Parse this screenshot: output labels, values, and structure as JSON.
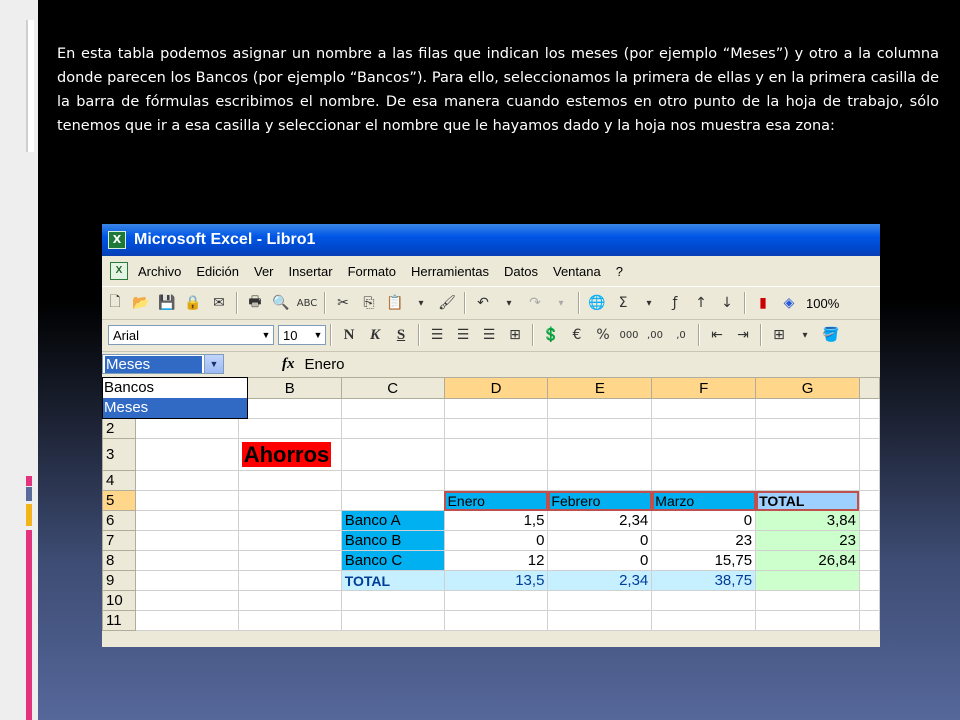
{
  "slide": {
    "paragraph": "En esta tabla podemos asignar un nombre a las filas que indican los meses (por ejemplo “Meses”) y otro a la columna donde parecen los Bancos (por ejemplo “Bancos”). Para ello, seleccionamos la primera de ellas y en la primera casilla de la barra de fórmulas escribimos el nombre. De esa manera cuando estemos en otro punto de la hoja de trabajo, sólo tenemos que ir a esa casilla y seleccionar el nombre que le hayamos dado y la hoja nos muestra esa zona:"
  },
  "excel": {
    "title": "Microsoft Excel - Libro1",
    "menu": [
      "Archivo",
      "Edición",
      "Ver",
      "Insertar",
      "Formato",
      "Herramientas",
      "Datos",
      "Ventana",
      "?"
    ],
    "zoom": "100%",
    "font_name": "Arial",
    "font_size": "10",
    "name_box": "Meses",
    "formula": "Enero",
    "name_options": [
      "Bancos",
      "Meses"
    ],
    "columns": [
      "A",
      "B",
      "C",
      "D",
      "E",
      "F",
      "G"
    ],
    "rows": {
      "r2": "2",
      "r3": "3",
      "r4": "4",
      "r5": "5",
      "r6": "6",
      "r7": "7",
      "r8": "8",
      "r9": "9",
      "r10": "10",
      "r11": "11"
    },
    "title_cell": "Ahorros",
    "headers": [
      "Enero",
      "Febrero",
      "Marzo",
      "TOTAL"
    ],
    "banks": [
      "Banco A",
      "Banco B",
      "Banco C"
    ],
    "values": [
      [
        "1,5",
        "2,34",
        "0",
        "3,84"
      ],
      [
        "0",
        "0",
        "23",
        "23"
      ],
      [
        "12",
        "0",
        "15,75",
        "26,84"
      ]
    ],
    "total_label": "TOTAL",
    "totals": [
      "13,5",
      "2,34",
      "38,75"
    ]
  }
}
